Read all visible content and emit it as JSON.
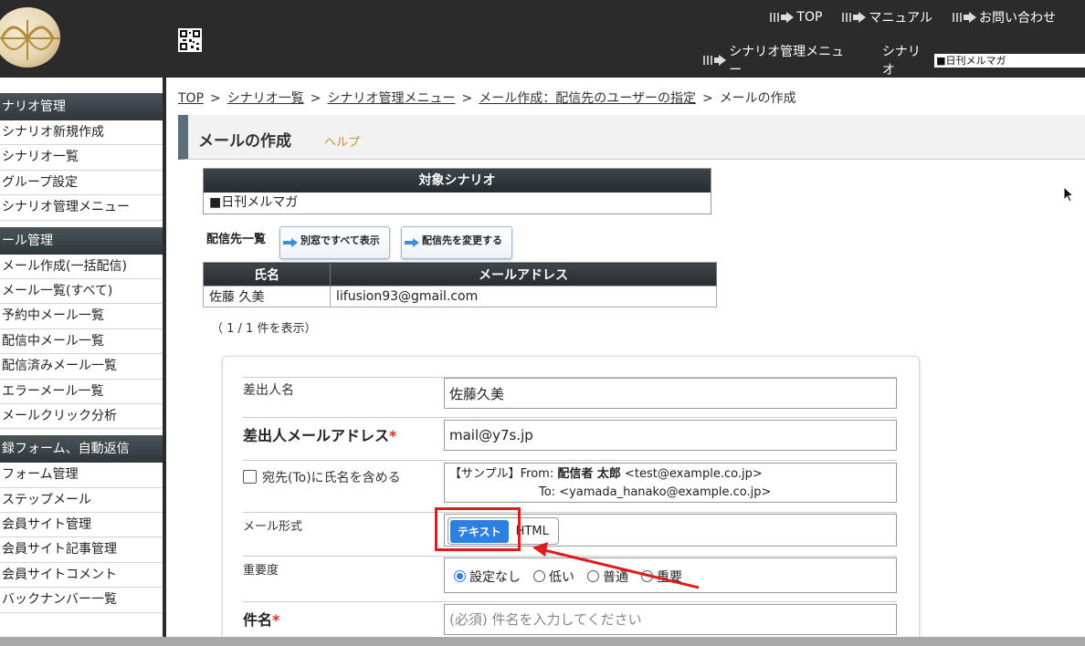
{
  "header": {
    "top_links": [
      "TOP",
      "マニュアル",
      "お問い合わせ"
    ],
    "sub_link": "シナリオ管理メニュー",
    "scenario_label": "シナリオ",
    "scenario_selected": "■日刊メルマガ"
  },
  "sidebar": {
    "sections": [
      {
        "title": "ナリオ管理",
        "items": [
          "シナリオ新規作成",
          "シナリオ一覧",
          "グループ設定",
          "シナリオ管理メニュー"
        ]
      },
      {
        "title": "ール管理",
        "items": [
          "メール作成(一括配信)",
          "メール一覧(すべて)",
          "予約中メール一覧",
          "配信中メール一覧",
          "配信済みメール一覧",
          "エラーメール一覧",
          "メールクリック分析"
        ]
      },
      {
        "title": "録フォーム、自動返信",
        "items": [
          "フォーム管理",
          "ステップメール",
          "会員サイト管理",
          "会員サイト記事管理",
          "会員サイトコメント",
          "バックナンバー一覧"
        ]
      }
    ]
  },
  "breadcrumb": {
    "items": [
      "TOP",
      "シナリオ一覧",
      "シナリオ管理メニュー",
      "メール作成：配信先のユーザーの指定"
    ],
    "current": "メールの作成",
    "separator": ">"
  },
  "page": {
    "title": "メールの作成",
    "help": "ヘルプ"
  },
  "target": {
    "header": "対象シナリオ",
    "value": "■日刊メルマガ"
  },
  "destinations": {
    "label": "配信先一覧",
    "show_all_button": "別窓ですべて表示",
    "change_button": "配信先を変更する",
    "columns": [
      "氏名",
      "メールアドレス"
    ],
    "rows": [
      [
        "佐藤 久美",
        "lifusion93@gmail.com"
      ]
    ],
    "count": "（ 1 / 1 件を表示）"
  },
  "form": {
    "sender_name_label": "差出人名",
    "sender_name_value": "佐藤久美",
    "sender_email_label": "差出人メールアドレス",
    "required_mark": "*",
    "sender_email_value": "mail@y7s.jp",
    "include_name_label": "宛先(To)に氏名を含める",
    "sample_prefix": "【サンプル】From: ",
    "sample_from_name": "配信者 太郎",
    "sample_from_addr": " <test@example.co.jp>",
    "sample_to": "To: <yamada_hanako@example.co.jp>",
    "format_label": "メール形式",
    "format_options": [
      "テキスト",
      "HTML"
    ],
    "format_selected": "テキスト",
    "priority_label": "重要度",
    "priority_options": [
      "設定なし",
      "低い",
      "普通",
      "重要"
    ],
    "priority_selected": "設定なし",
    "subject_label": "件名",
    "subject_placeholder": "(必須) 件名を入力してください"
  },
  "colors": {
    "header_bg": "#2b2b2b",
    "accent_blue": "#2f7fe0",
    "annotation_red": "#e01b1b",
    "help_link": "#c8922a"
  }
}
